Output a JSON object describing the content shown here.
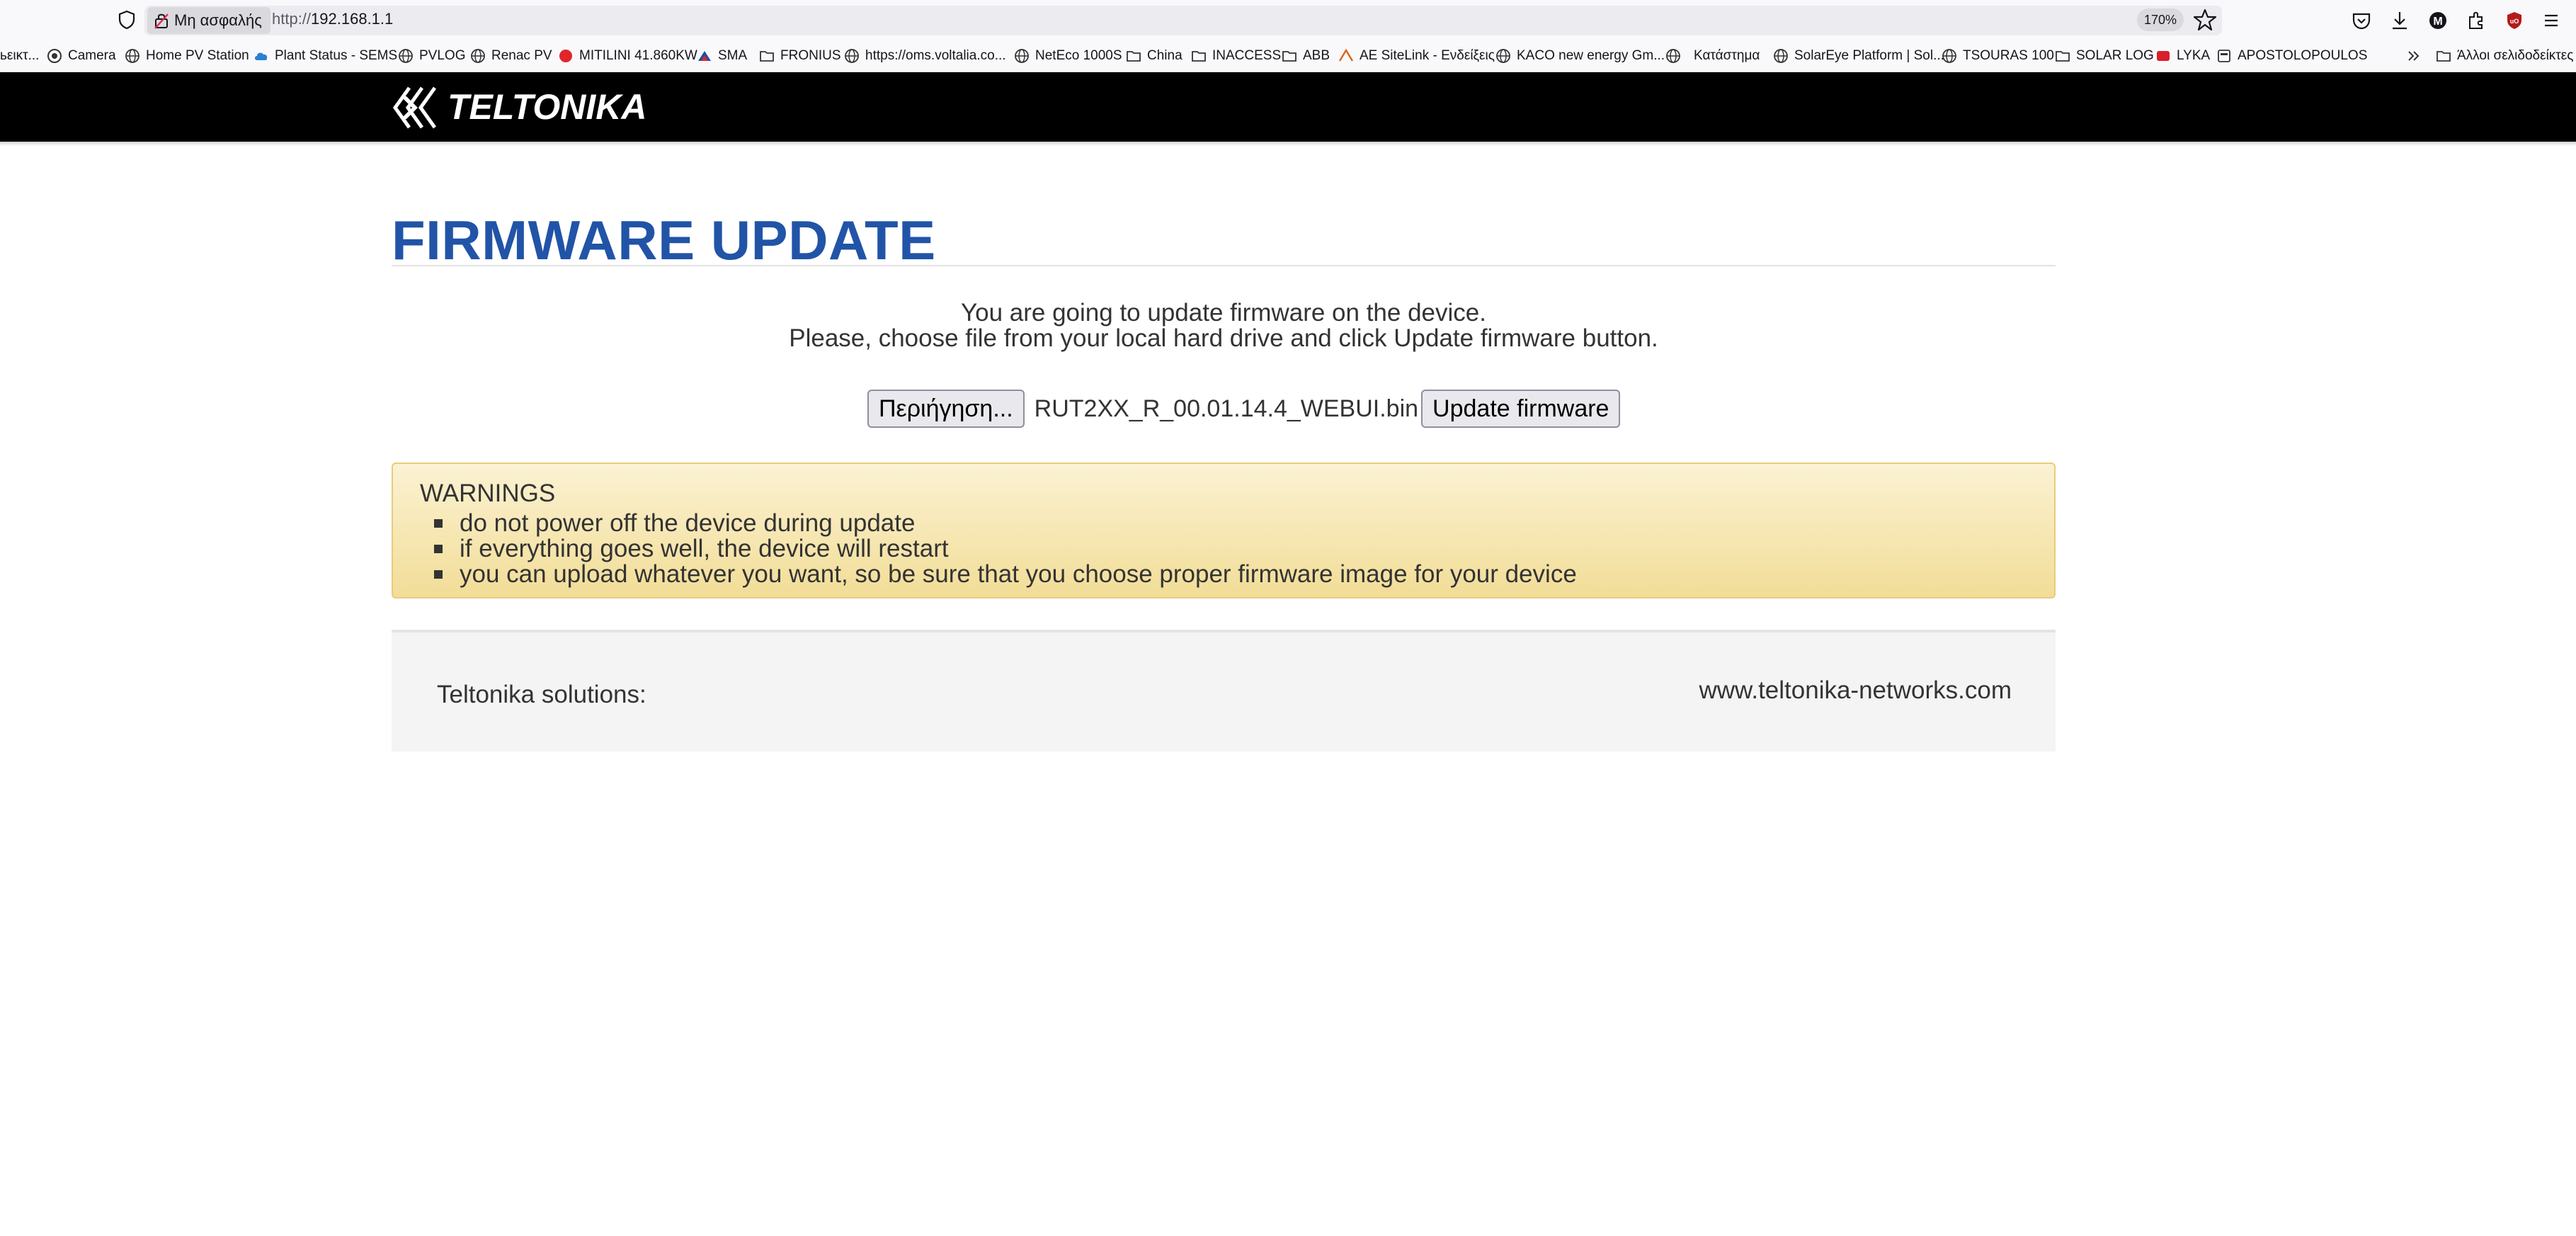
{
  "browser": {
    "security_label": "Μη ασφαλής",
    "url_scheme": "http://",
    "url_host": "192.168.1.1",
    "zoom": "170%",
    "bookmarks": [
      {
        "label": "ьεικτ..."
      },
      {
        "label": "Camera"
      },
      {
        "label": "Home PV Station"
      },
      {
        "label": "Plant Status - SEMS"
      },
      {
        "label": "PVLOG"
      },
      {
        "label": "Renac PV"
      },
      {
        "label": "MITILINI 41.860KW"
      },
      {
        "label": "SMA"
      },
      {
        "label": "FRONIUS"
      },
      {
        "label": "https://oms.voltalia.co..."
      },
      {
        "label": "NetEco 1000S"
      },
      {
        "label": "China"
      },
      {
        "label": "INACCESS"
      },
      {
        "label": "ABB"
      },
      {
        "label": "AE SiteLink - Ενδείξεις"
      },
      {
        "label": "KACO new energy Gm..."
      },
      {
        "label": "Κατάστημα"
      },
      {
        "label": "SolarEye Platform | Sol..."
      },
      {
        "label": "TSOURAS 100"
      },
      {
        "label": "SOLAR LOG"
      },
      {
        "label": "LYKA"
      },
      {
        "label": "APOSTOLOPOULOS"
      }
    ],
    "other_bookmarks": "Άλλοι σελιδοδείκτες"
  },
  "header": {
    "logo_text": "TELTONIKA"
  },
  "main": {
    "title": "FIRMWARE UPDATE",
    "intro_line1": "You are going to update firmware on the device.",
    "intro_line2": "Please, choose file from your local hard drive and click Update firmware button.",
    "browse_label": "Περιήγηση...",
    "file_name": "RUT2XX_R_00.01.14.4_WEBUI.bin",
    "update_label": "Update firmware"
  },
  "warnings": {
    "title": "WARNINGS",
    "items": [
      "do not power off the device during update",
      "if everything goes well, the device will restart",
      "you can upload whatever you want, so be sure that you choose proper firmware image for your device"
    ]
  },
  "footer": {
    "left": "Teltonika solutions:",
    "right": "www.teltonika-networks.com"
  }
}
